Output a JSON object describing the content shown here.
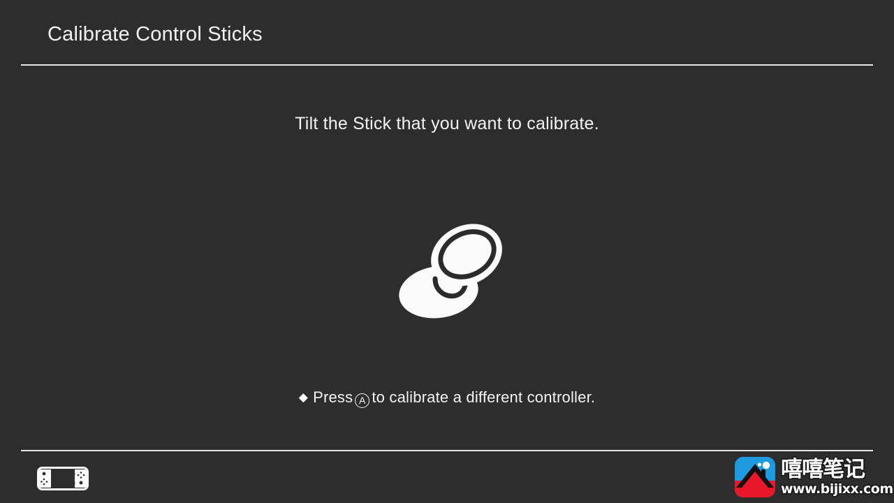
{
  "screen": {
    "background_color": "#2d2d2d",
    "text_color": "#f4f4f4",
    "divider_color": "#e8e8e8"
  },
  "header": {
    "title": "Calibrate Control Sticks"
  },
  "main": {
    "instruction": "Tilt the Stick that you want to calibrate.",
    "illustration_icon": "control-stick-tilted-icon"
  },
  "hint": {
    "bullet": "◆",
    "text_before": "Press",
    "button_glyph": "A",
    "text_after": "to calibrate a different controller.",
    "full_text": "◆ Press Ⓐ to calibrate a different controller."
  },
  "footer": {
    "console_icon": "switch-console-icon"
  },
  "watermark": {
    "logo_icon": "mountain-photo-logo-icon",
    "brand_cn": "嘻嘻笔记",
    "url": "www.bijixx.com",
    "logo_blue": "#1e9ae0",
    "logo_red": "#e8172a",
    "logo_dark": "#111111"
  }
}
